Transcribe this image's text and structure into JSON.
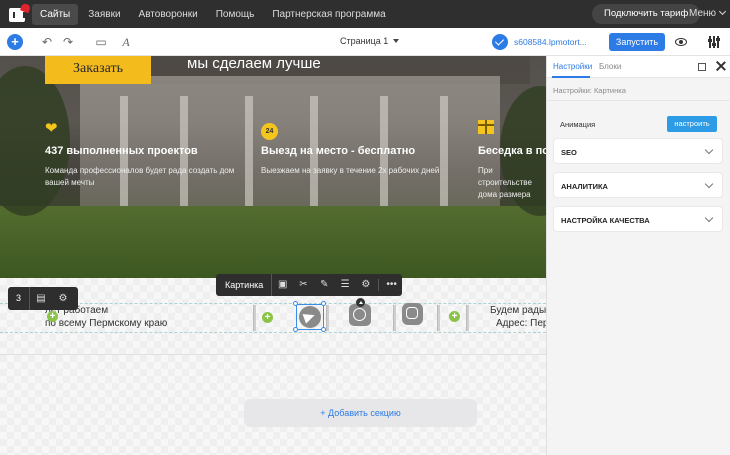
{
  "topnav": {
    "items": [
      "Сайты",
      "Заявки",
      "Автоворонки",
      "Помощь",
      "Партнерская программа"
    ],
    "active_index": 0,
    "tariff_button": "Подключить тариф",
    "menu_label": "Меню"
  },
  "toolbar": {
    "page_select": "Страница 1",
    "domain": "s608584.lpmotort...",
    "launch_button": "Запустить"
  },
  "hero": {
    "order_button": "Заказать",
    "headline": "мы сделаем лучше",
    "features": [
      {
        "icon": "handshake-heart-icon",
        "title": "437 выполненных проектов",
        "desc": "Команда профессионалов будет рада создать дом вашей мечты"
      },
      {
        "icon": "24-hours-icon",
        "badge": "24",
        "title": "Выезд на место - бесплатно",
        "desc": "Выезжаем на заявку в течение 2х рабочих дней"
      },
      {
        "icon": "gift-icon",
        "title": "Беседка в подарок",
        "desc": "При строительстве дома размера"
      }
    ]
  },
  "section": {
    "left_text_line1": "лет работаем",
    "left_text_line2": "по всему Пермскому краю",
    "right_text_line1": "Будем рады",
    "right_text_line2": "Адрес: Пер",
    "add_section": "+ Добавить секцию"
  },
  "element_toolbar": {
    "label": "Картинка"
  },
  "mini_toolbar": {
    "number": "3"
  },
  "panel": {
    "tabs": [
      "Настройки",
      "Блоки"
    ],
    "active_tab": 0,
    "breadcrumb": "Настройки: Картинка",
    "animation_label": "Анимация",
    "animation_button": "настроить",
    "accordions": [
      "SEO",
      "АНАЛИТИКА",
      "НАСТРОЙКА КАЧЕСТВА"
    ]
  },
  "colors": {
    "accent": "#2d7be5",
    "cta_yellow": "#f4bb1c",
    "topbar": "#2f2f2f"
  }
}
